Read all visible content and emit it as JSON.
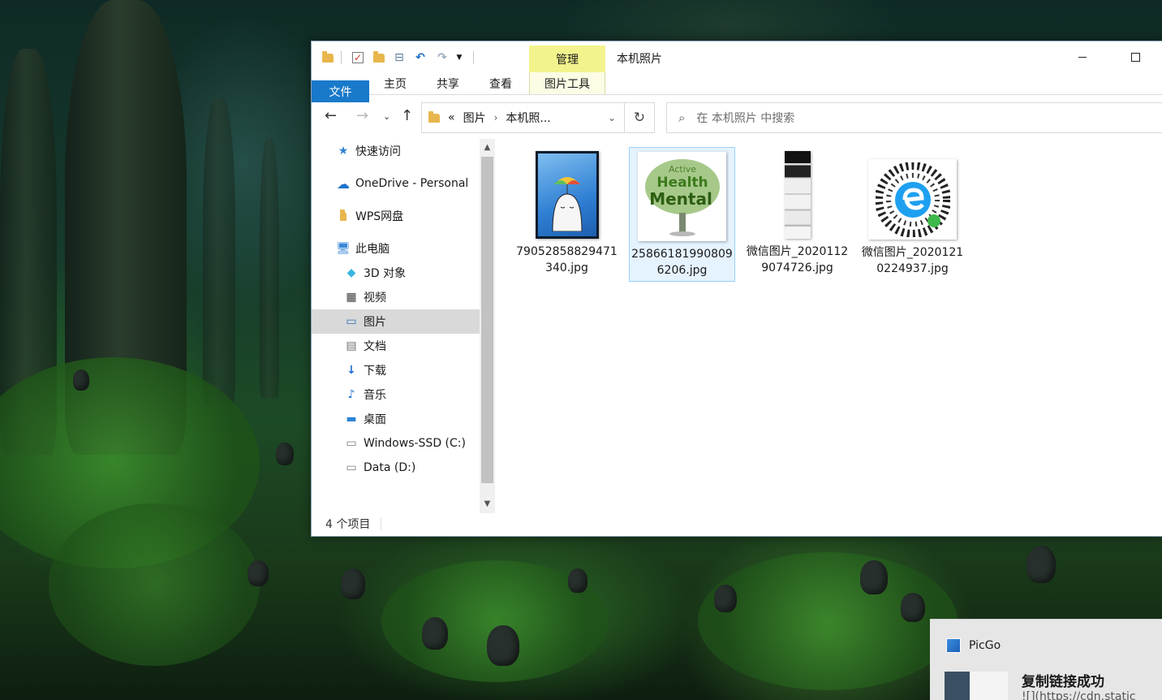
{
  "window": {
    "title": "本机照片",
    "context_tab_group": "管理",
    "ribbon_tabs": [
      "文件",
      "主页",
      "共享",
      "查看",
      "图片工具"
    ]
  },
  "navigation": {
    "address": {
      "prefix": "«",
      "crumbs": [
        "图片",
        "本机照..."
      ]
    },
    "search_placeholder": "在 本机照片 中搜索"
  },
  "sidebar": {
    "items": [
      {
        "label": "快速访问",
        "icon": "star-icon",
        "indent": 0
      },
      {
        "label": "OneDrive - Personal",
        "icon": "cloud-icon",
        "indent": 0
      },
      {
        "label": "WPS网盘",
        "icon": "folder-icon",
        "indent": 0
      },
      {
        "label": "此电脑",
        "icon": "computer-icon",
        "indent": 0
      },
      {
        "label": "3D 对象",
        "icon": "cube-icon",
        "indent": 1
      },
      {
        "label": "视频",
        "icon": "film-icon",
        "indent": 1
      },
      {
        "label": "图片",
        "icon": "picture-icon",
        "indent": 1,
        "selected": true
      },
      {
        "label": "文档",
        "icon": "document-icon",
        "indent": 1
      },
      {
        "label": "下载",
        "icon": "download-icon",
        "indent": 1
      },
      {
        "label": "音乐",
        "icon": "music-icon",
        "indent": 1
      },
      {
        "label": "桌面",
        "icon": "desktop-icon",
        "indent": 1
      },
      {
        "label": "Windows-SSD (C:)",
        "icon": "drive-icon",
        "indent": 1
      },
      {
        "label": "Data (D:)",
        "icon": "drive-icon",
        "indent": 1
      }
    ]
  },
  "files": [
    {
      "name": "79052858829471340.jpg",
      "thumb": "umbrella-illustration"
    },
    {
      "name": "258661819908096206.jpg",
      "thumb": "mental-health-word-cloud",
      "selected": true
    },
    {
      "name": "微信图片_20201129074726.jpg",
      "thumb": "screenshot-strip"
    },
    {
      "name": "微信图片_20201210224937.jpg",
      "thumb": "mini-program-code"
    }
  ],
  "thumb_text": {
    "line1": "Active",
    "line2": "Health",
    "line3": "Mental"
  },
  "status": {
    "item_count": "4 个项目"
  },
  "toast": {
    "app": "PicGo",
    "title": "复制链接成功",
    "body": "![](https://cdn.static"
  },
  "colors": {
    "accent": "#1979ca",
    "context_tab": "#f3f38d",
    "selection": "#d9d9d9"
  }
}
